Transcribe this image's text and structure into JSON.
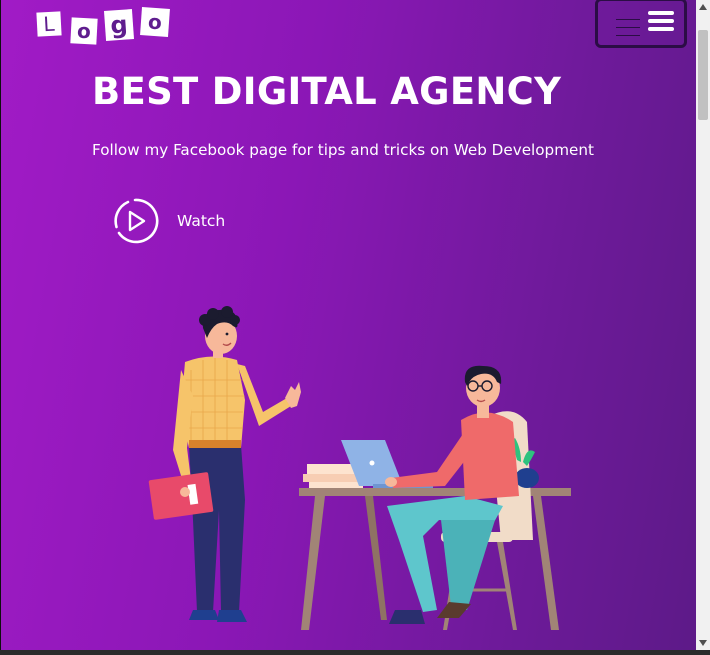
{
  "logo": {
    "letters": [
      "L",
      "o",
      "g",
      "o"
    ]
  },
  "menu": {
    "icon": "hamburger-icon"
  },
  "hero": {
    "title": "BEST DIGITAL AGENCY",
    "subtitle": "Follow my Facebook page for tips and tricks on Web Development",
    "watch_label": "Watch",
    "watch_icon": "play-circle-icon"
  },
  "colors": {
    "gradient_start": "#a11bc6",
    "gradient_end": "#5d1a88",
    "text": "#ffffff"
  }
}
